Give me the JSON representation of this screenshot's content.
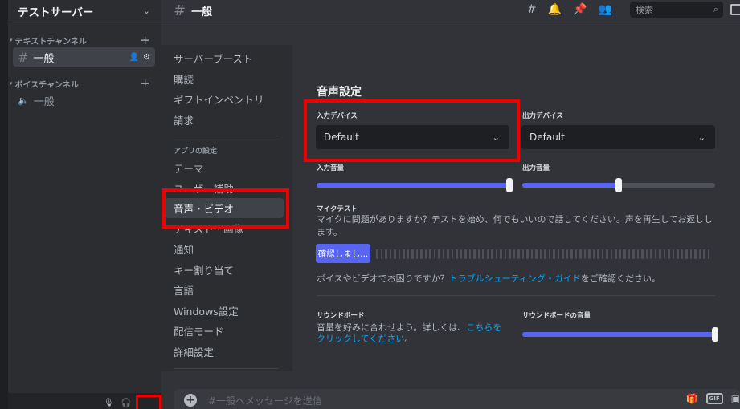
{
  "server": {
    "name": "テストサーバー",
    "categories": [
      {
        "name": "テキストチャンネル",
        "channels": [
          {
            "name": "一般",
            "type": "text",
            "active": true
          }
        ]
      },
      {
        "name": "ボイスチャンネル",
        "channels": [
          {
            "name": "一般",
            "type": "voice",
            "active": false
          }
        ]
      }
    ]
  },
  "header": {
    "channel_name": "一般",
    "search_placeholder": "検索",
    "icons": [
      "threads-icon",
      "bell-icon",
      "pin-icon",
      "members-icon",
      "inbox-icon"
    ]
  },
  "settings_nav": {
    "items_top": [
      "サーバーブースト",
      "購読",
      "ギフトインベントリ",
      "請求"
    ],
    "section_heading": "アプリの設定",
    "items_app": [
      "テーマ",
      "ユーザー補助",
      "音声・ビデオ",
      "テキスト・画像",
      "通知",
      "キー割り当て",
      "言語",
      "Windows設定",
      "配信モード",
      "詳細設定"
    ],
    "active_item": "音声・ビデオ"
  },
  "voice": {
    "title": "音声設定",
    "input_device_label": "入力デバイス",
    "input_device_value": "Default",
    "output_device_label": "出力デバイス",
    "output_device_value": "Default",
    "input_volume_label": "入力音量",
    "input_volume": 1.0,
    "output_volume_label": "出力音量",
    "output_volume": 0.5,
    "mic_test_label": "マイクテスト",
    "mic_test_desc": "マイクに問題がありますか？テストを始め、何でもいいので話してください。声を再生してお返しします。",
    "mic_test_button": "確認しまし...",
    "help_prefix": "ボイスやビデオでお困りですか？",
    "help_link": "トラブルシューティング・ガイド",
    "help_suffix": "をご確認ください。",
    "soundboard_label": "サウンドボード",
    "soundboard_desc_prefix": "音量を好みに合わせよう。詳しくは、",
    "soundboard_desc_link": "こちらをクリックしてください",
    "soundboard_desc_suffix": "。",
    "soundboard_volume_label": "サウンドボードの音量",
    "soundboard_volume": 1.0
  },
  "message_bar": {
    "placeholder": "#一般へメッセージを送信",
    "gif_label": "GIF"
  },
  "colors": {
    "highlight_box": "#ee0000",
    "accent": "#5865f2",
    "link": "#00a8fc"
  }
}
